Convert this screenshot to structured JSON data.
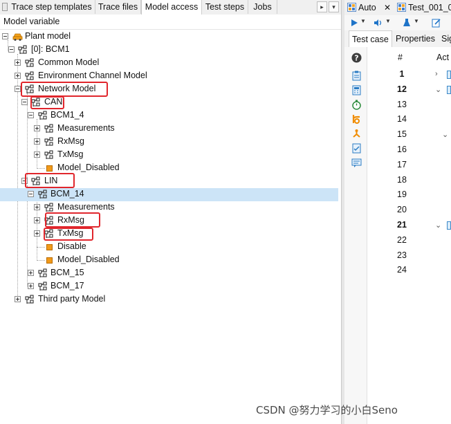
{
  "left_tabs": [
    "Trace step templates",
    "Trace files",
    "Model access",
    "Test steps",
    "Jobs"
  ],
  "nav": {
    "right_arrow": "▸",
    "down_arrow": "▾"
  },
  "column_header": "Model variable",
  "tree": {
    "plant_model": "Plant model",
    "bcm1": "[0]: BCM1",
    "common_model": "Common Model",
    "env_channel_model": "Environment Channel Model",
    "network_model": "Network Model",
    "can": "CAN",
    "bcm1_4": "BCM1_4",
    "can_measurements": "Measurements",
    "can_rxmsg": "RxMsg",
    "can_txmsg": "TxMsg",
    "can_model_disabled": "Model_Disabled",
    "lin": "LIN",
    "bcm_14": "BCM_14",
    "lin_measurements": "Measurements",
    "lin_rxmsg": "RxMsg",
    "lin_txmsg": "TxMsg",
    "lin_disable": "Disable",
    "lin_model_disabled": "Model_Disabled",
    "bcm_15": "BCM_15",
    "bcm_17": "BCM_17",
    "third_party_model": "Third party Model"
  },
  "right": {
    "tabs": [
      "Auto",
      "Test_001_0"
    ],
    "subtabs": [
      "Test case",
      "Properties",
      "Sig"
    ],
    "columns": [
      "#",
      "Act"
    ],
    "rows": [
      "1",
      "12",
      "13",
      "14",
      "15",
      "16",
      "17",
      "18",
      "19",
      "20",
      "21",
      "22",
      "23",
      "24"
    ],
    "bold_rows": [
      "1",
      "12",
      "21"
    ]
  },
  "watermark": "CSDN @努力学习的小白Seno",
  "colors": {
    "highlight_box": "#e0262c",
    "selected_row": "#cce4f7",
    "leaf_square": "#f19a1a"
  }
}
